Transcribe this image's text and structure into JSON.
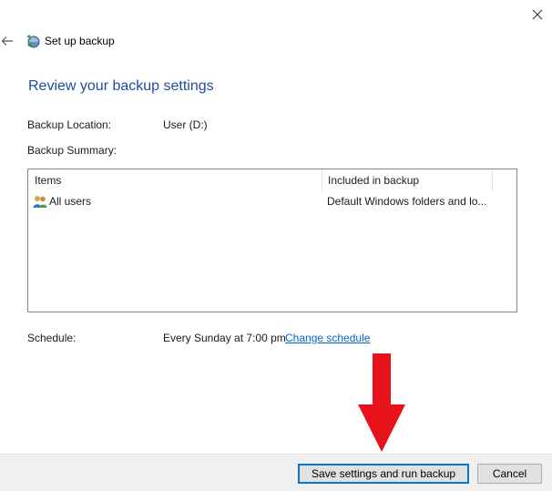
{
  "window": {
    "title": "Set up backup"
  },
  "main": {
    "heading": "Review your backup settings",
    "backup_location_label": "Backup Location:",
    "backup_location_value": "User (D:)",
    "backup_summary_label": "Backup Summary:",
    "table": {
      "columns": [
        "Items",
        "Included in backup"
      ],
      "rows": [
        {
          "item": "All users",
          "included": "Default Windows folders and lo...",
          "icon": "users-icon"
        }
      ]
    },
    "schedule_label": "Schedule:",
    "schedule_value": "Every Sunday at 7:00 pm",
    "change_schedule_link": "Change schedule"
  },
  "footer": {
    "save_button": "Save settings and run backup",
    "cancel_button": "Cancel"
  },
  "colors": {
    "heading": "#1e4d9e",
    "link": "#0066cc",
    "arrow": "#e8121b",
    "primary_border": "#0078d7"
  }
}
